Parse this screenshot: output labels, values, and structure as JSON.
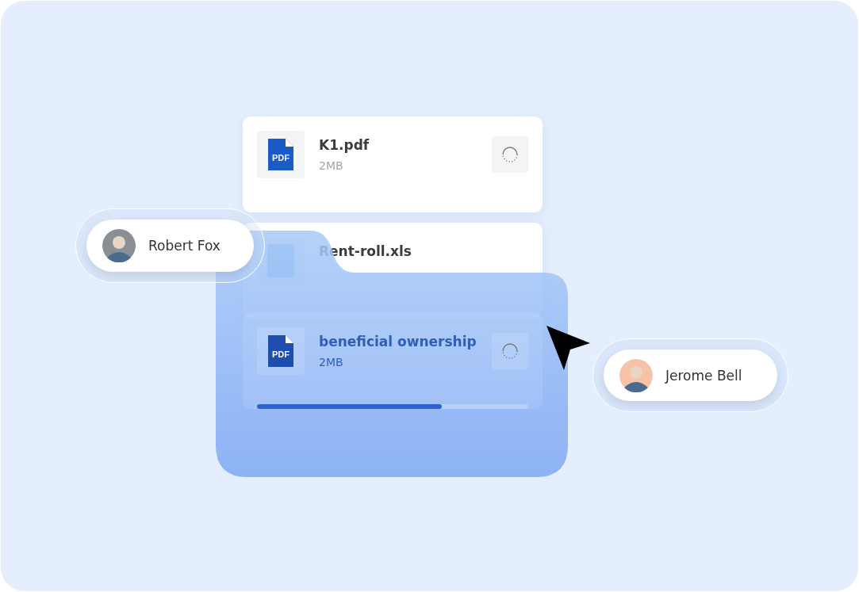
{
  "files": [
    {
      "name": "K1.pdf",
      "size": "2MB",
      "kind": "pdf",
      "icon_label": "PDF",
      "loading": true,
      "covered": false
    },
    {
      "name": "Rent-roll.xls",
      "kind": "xls",
      "loading": false,
      "covered": false
    },
    {
      "name": "beneficial ownership",
      "size": "2MB",
      "kind": "pdf",
      "icon_label": "PDF",
      "loading": true,
      "covered": true,
      "level": 0.68
    }
  ],
  "users": [
    {
      "name": "Robert Fox"
    },
    {
      "name": "Jerome Bell"
    }
  ]
}
